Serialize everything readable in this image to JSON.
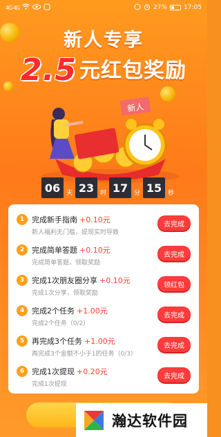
{
  "status_bar": {
    "left_signals": "4G 4G",
    "battery": "27%",
    "time": "17:05"
  },
  "header": {
    "title": "新人专享",
    "amount": "2.5",
    "amount_suffix": "元红包奖励"
  },
  "illustration": {
    "tag_text": "新人"
  },
  "countdown": {
    "days": "06",
    "days_unit": "天",
    "hours": "23",
    "hours_unit": "时",
    "minutes": "17",
    "minutes_unit": "分",
    "seconds": "15",
    "seconds_unit": "秒"
  },
  "tasks": [
    {
      "num": "1",
      "title": "完成新手指南",
      "reward": "+0.10元",
      "desc": "新人福利无门槛，提现实时导致",
      "button": "去完成"
    },
    {
      "num": "2",
      "title": "完成简单答题",
      "reward": "+0.10元",
      "desc": "完成简单答题，领取奖励",
      "button": "去完成"
    },
    {
      "num": "3",
      "title": "完成1次朋友圈分享",
      "reward": "+0.10元",
      "desc": "完成1次分享，领取奖励",
      "button": "领红包"
    },
    {
      "num": "4",
      "title": "完成2个任务",
      "reward": "+1.00元",
      "desc": "完成2个任务（0/2）",
      "button": "去完成"
    },
    {
      "num": "5",
      "title": "再完成3个任务",
      "reward": "+1.00元",
      "desc": "再完成3个金额不小于1的任务（0/3）",
      "button": "去完成"
    },
    {
      "num": "6",
      "title": "完成1次提现",
      "reward": "+0.20元",
      "desc": "完成1次提现",
      "button": "去完成"
    }
  ],
  "watermark": {
    "text": "瀚达软件园"
  },
  "colors": {
    "bg_orange": "#ff8a1f",
    "red_button": "#ff3b3b",
    "reward_red": "#ff3b30",
    "amount_red": "#ff2a2a",
    "countdown_box": "#2d2d35"
  }
}
